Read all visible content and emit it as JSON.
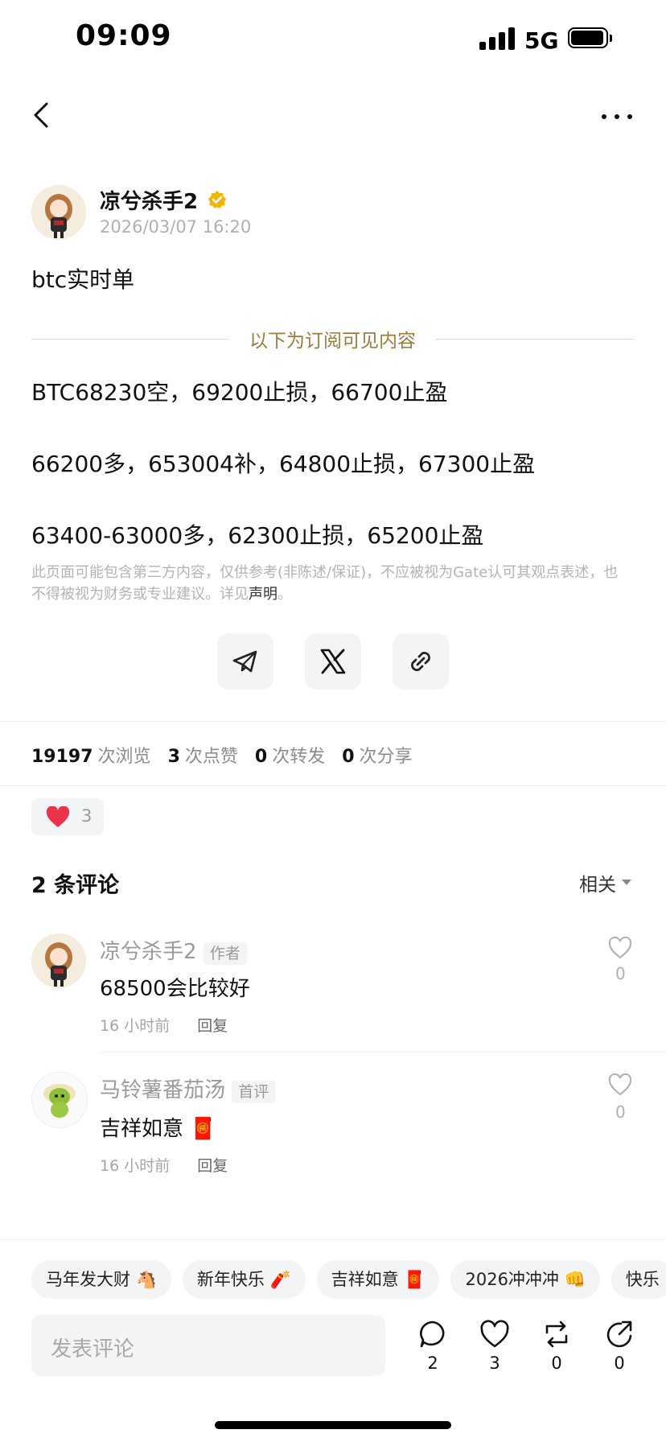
{
  "status_bar": {
    "time": "09:09",
    "network": "5G"
  },
  "post": {
    "author": "凉兮杀手2",
    "time": "2026/03/07 16:20",
    "title": "btc实时单",
    "subscribe_divider": "以下为订阅可见内容",
    "lines": [
      "BTC68230空，69200止损，66700止盈",
      "66200多，653004补，64800止损，67300止盈",
      "63400-63000多，62300止损，65200止盈"
    ],
    "disclaimer": "此页面可能包含第三方内容，仅供参考(非陈述/保证)，不应被视为Gate认可其观点表述，也不得被视为财务或专业建议。详见",
    "disclaimer_link": "声明",
    "disclaimer_end": "。"
  },
  "stats": {
    "views": "19197",
    "views_label": "次浏览",
    "likes": "3",
    "likes_label": "次点赞",
    "reposts": "0",
    "reposts_label": "次转发",
    "shares": "0",
    "shares_label": "次分享"
  },
  "reactions": {
    "heart_count": "3"
  },
  "comments_section": {
    "title": "2 条评论",
    "sort_label": "相关",
    "reply_label": "回复",
    "items": [
      {
        "name": "凉兮杀手2",
        "tag": "作者",
        "text": "68500会比较好",
        "time": "16 小时前",
        "likes": "0"
      },
      {
        "name": "马铃薯番茄汤",
        "tag": "首评",
        "text": "吉祥如意 🧧",
        "time": "16 小时前",
        "likes": "0"
      }
    ]
  },
  "quick_replies": [
    "马年发大财 🐴",
    "新年快乐 🧨",
    "吉祥如意 🧧",
    "2026冲冲冲 👊",
    "快乐"
  ],
  "bottom_bar": {
    "placeholder": "发表评论",
    "comment_count": "2",
    "like_count": "3",
    "repost_count": "0",
    "share_count": "0"
  },
  "colors": {
    "accent_gold": "#9c7c3d",
    "heart_red": "#e8334a",
    "verified_gold": "#f2b705"
  },
  "icons": [
    "back-arrow-icon",
    "more-icon",
    "verified-icon",
    "telegram-icon",
    "x-icon",
    "link-icon",
    "heart-icon",
    "comment-icon",
    "repost-icon",
    "share-icon"
  ]
}
